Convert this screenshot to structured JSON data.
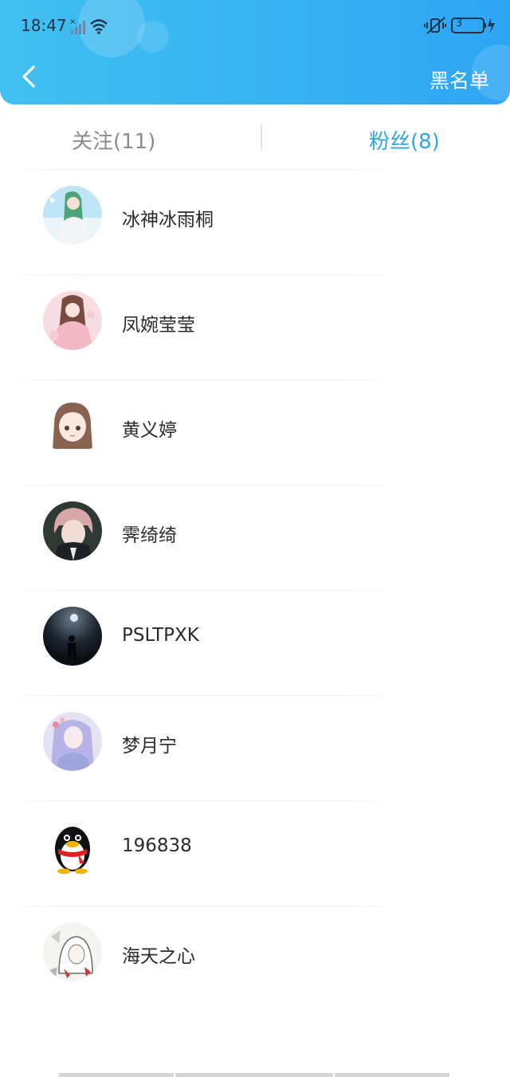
{
  "status": {
    "time": "18:47",
    "battery": "3"
  },
  "nav": {
    "back_icon": "chevron-left-icon",
    "blacklist_label": "黑名单"
  },
  "tabs": [
    {
      "label": "关注(11)",
      "active": false
    },
    {
      "label": "粉丝(8)",
      "active": true
    }
  ],
  "colors": {
    "header": "#37b2f2",
    "active_tab": "#31a6e4",
    "inactive_tab": "#8c8c8c"
  },
  "fans": [
    {
      "name": "冰神冰雨桐",
      "avatar": "anime-girl-blue-avatar"
    },
    {
      "name": "凤婉莹莹",
      "avatar": "anime-girl-pink-avatar"
    },
    {
      "name": "黄义婷",
      "avatar": "chibi-girl-avatar"
    },
    {
      "name": "霁绮绮",
      "avatar": "anime-boy-avatar"
    },
    {
      "name": "PSLTPXK",
      "avatar": "moon-silhouette-avatar"
    },
    {
      "name": "梦月宁",
      "avatar": "anime-girl-lavender-avatar"
    },
    {
      "name": "196838",
      "avatar": "qq-penguin-avatar"
    },
    {
      "name": "海天之心",
      "avatar": "sketch-girl-avatar"
    }
  ]
}
